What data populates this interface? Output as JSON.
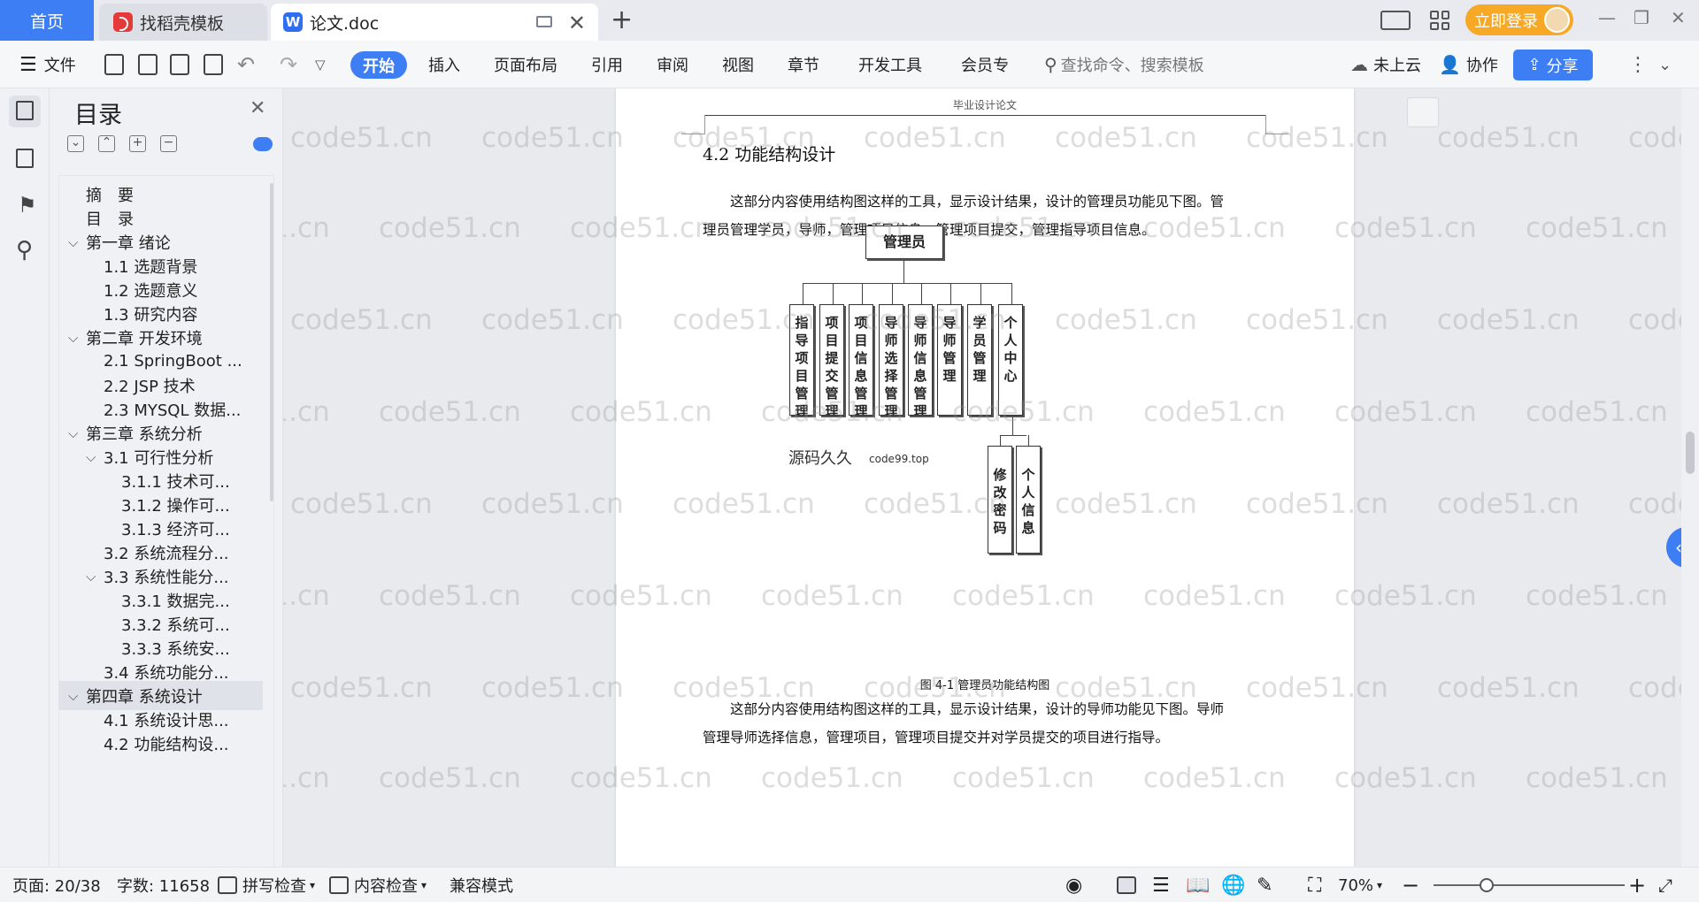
{
  "tabs": {
    "home": "首页",
    "docer": "找稻壳模板",
    "doc": "论文.doc",
    "login": "立即登录"
  },
  "ribbon": {
    "file": "文件",
    "items": [
      "开始",
      "插入",
      "页面布局",
      "引用",
      "审阅",
      "视图",
      "章节",
      "开发工具",
      "会员专"
    ],
    "search_placeholder": "查找命令、搜索模板",
    "cloud": "未上云",
    "collab": "协作",
    "share": "分享"
  },
  "toc": {
    "title": "目录",
    "items": [
      {
        "label": "摘　要",
        "level": 0,
        "caret": ""
      },
      {
        "label": "目　录",
        "level": 0,
        "caret": ""
      },
      {
        "label": "第一章  绪论",
        "level": 0,
        "caret": "v"
      },
      {
        "label": "1.1  选题背景",
        "level": 1,
        "caret": ""
      },
      {
        "label": "1.2  选题意义",
        "level": 1,
        "caret": ""
      },
      {
        "label": "1.3  研究内容",
        "level": 1,
        "caret": ""
      },
      {
        "label": "第二章  开发环境",
        "level": 0,
        "caret": "v"
      },
      {
        "label": "2.1 SpringBoot ...",
        "level": 1,
        "caret": ""
      },
      {
        "label": "2.2 JSP 技术",
        "level": 1,
        "caret": ""
      },
      {
        "label": "2.3 MYSQL 数据...",
        "level": 1,
        "caret": ""
      },
      {
        "label": "第三章  系统分析",
        "level": 0,
        "caret": "v"
      },
      {
        "label": "3.1 可行性分析",
        "level": 1,
        "caret": "v"
      },
      {
        "label": "3.1.1 技术可...",
        "level": 2,
        "caret": ""
      },
      {
        "label": "3.1.2 操作可...",
        "level": 2,
        "caret": ""
      },
      {
        "label": "3.1.3 经济可...",
        "level": 2,
        "caret": ""
      },
      {
        "label": "3.2 系统流程分...",
        "level": 1,
        "caret": ""
      },
      {
        "label": "3.3 系统性能分...",
        "level": 1,
        "caret": "v"
      },
      {
        "label": "3.3.1 数据完...",
        "level": 2,
        "caret": ""
      },
      {
        "label": "3.3.2 系统可...",
        "level": 2,
        "caret": ""
      },
      {
        "label": "3.3.3 系统安...",
        "level": 2,
        "caret": ""
      },
      {
        "label": "3.4 系统功能分...",
        "level": 1,
        "caret": ""
      },
      {
        "label": "第四章  系统设计",
        "level": 0,
        "caret": "v",
        "selected": true
      },
      {
        "label": "4.1  系统设计思...",
        "level": 1,
        "caret": ""
      },
      {
        "label": "4.2 功能结构设...",
        "level": 1,
        "caret": ""
      }
    ]
  },
  "document": {
    "header": "毕业设计论文",
    "section_title": "4.2 功能结构设计",
    "para1_line1": "这部分内容使用结构图这样的工具，显示设计结果，设计的管理员功能见下图。管",
    "para1_line2": "理员管理学员，导师，管理项目信息，管理项目提交，管理指导项目信息。",
    "diagram": {
      "root": "管理员",
      "children": [
        "指导项目管理",
        "项目提交管理",
        "项目信息管理",
        "导师选择管理",
        "导师信息管理",
        "导师管理",
        "学员管理",
        "个人中心"
      ],
      "sub_children": [
        "修改密码",
        "个人信息"
      ]
    },
    "source_mark": "源码久久",
    "source_mark_url": "code99.top",
    "caption": "图 4-1  管理员功能结构图",
    "para2_line1": "这部分内容使用结构图这样的工具，显示设计结果，设计的导师功能见下图。导师",
    "para2_line2": "管理导师选择信息，管理项目，管理项目提交并对学员提交的项目进行指导。",
    "watermark": "code51.cn"
  },
  "status": {
    "page": "页面: 20/38",
    "words": "字数: 11658",
    "spell": "拼写检查",
    "content_check": "内容检查",
    "compat": "兼容模式",
    "zoom": "70%"
  }
}
